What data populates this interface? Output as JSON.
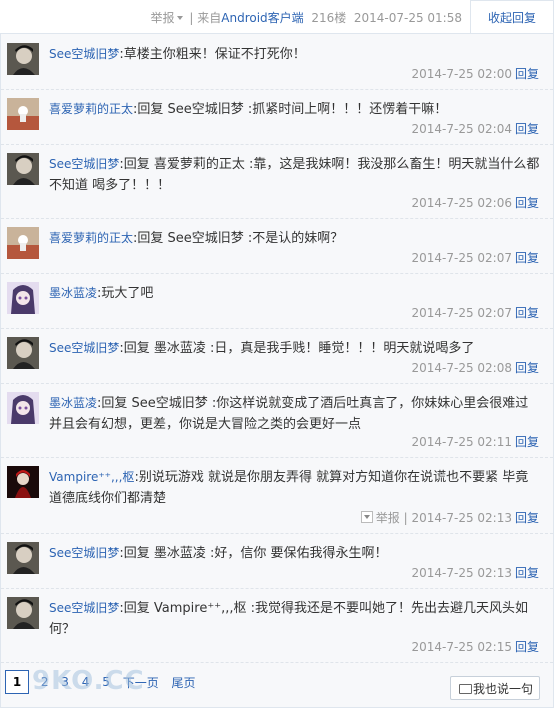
{
  "header": {
    "report_label": "举报",
    "sep": "|",
    "from_prefix": "来自",
    "from_client": "Android客户端",
    "floor": "216楼",
    "timestamp": "2014-07-25 01:58",
    "collapse_label": "收起回复"
  },
  "replies": [
    {
      "user": "See空城旧梦",
      "text": "草楼主你粗来！保证不打死你！",
      "time": "2014-7-25 02:00",
      "action": "回复"
    },
    {
      "user": "喜爱萝莉的正太",
      "text": "回复 See空城旧梦 :抓紧时间上啊！！！还愣着干嘛！",
      "time": "2014-7-25 02:04",
      "action": "回复"
    },
    {
      "user": "See空城旧梦",
      "text": "回复 喜爱萝莉的正太 :靠，这是我妹啊！我没那么畜生！明天就当什么都不知道 喝多了！！！",
      "time": "2014-7-25 02:06",
      "action": "回复"
    },
    {
      "user": "喜爱萝莉的正太",
      "text": "回复 See空城旧梦 :不是认的妹啊？",
      "time": "2014-7-25 02:07",
      "action": "回复"
    },
    {
      "user": "墨冰蓝凌",
      "text": "玩大了吧",
      "time": "2014-7-25 02:07",
      "action": "回复"
    },
    {
      "user": "See空城旧梦",
      "text": "回复 墨冰蓝凌 :日，真是我手贱！睡觉！！！明天就说喝多了",
      "time": "2014-7-25 02:08",
      "action": "回复"
    },
    {
      "user": "墨冰蓝凌",
      "text": "回复 See空城旧梦 :你这样说就变成了酒后吐真言了，你妹妹心里会很难过并且会有幻想，更差，你说是大冒险之类的会更好一点",
      "time": "2014-7-25 02:11",
      "action": "回复"
    },
    {
      "user": "Vampire⁺⁺,,,枢",
      "text": "别说玩游戏 就说是你朋友弄得 就算对方知道你在说谎也不要紧 毕竟道德底线你们都清楚",
      "time": "2014-7-25 02:13",
      "action": "回复",
      "report": "举报",
      "sep": "|"
    },
    {
      "user": "See空城旧梦",
      "text": "回复 墨冰蓝凌 :好，信你 要保佑我得永生啊！",
      "time": "2014-7-25 02:13",
      "action": "回复"
    },
    {
      "user": "See空城旧梦",
      "text": "回复 Vampire⁺⁺,,,枢 :我觉得我还是不要叫她了！先出去避几天风头如何？",
      "time": "2014-7-25 02:15",
      "action": "回复"
    }
  ],
  "pager": {
    "current": "1",
    "pages": [
      "2",
      "3",
      "4",
      "5"
    ],
    "next": "下一页",
    "last": "尾页"
  },
  "watermark": "9KO.CC",
  "say_button": "我也说一句",
  "colors": {
    "link": "#2d64b3",
    "muted": "#999999",
    "panel_bg": "#f7f8fa",
    "border": "#dfe6ee"
  }
}
